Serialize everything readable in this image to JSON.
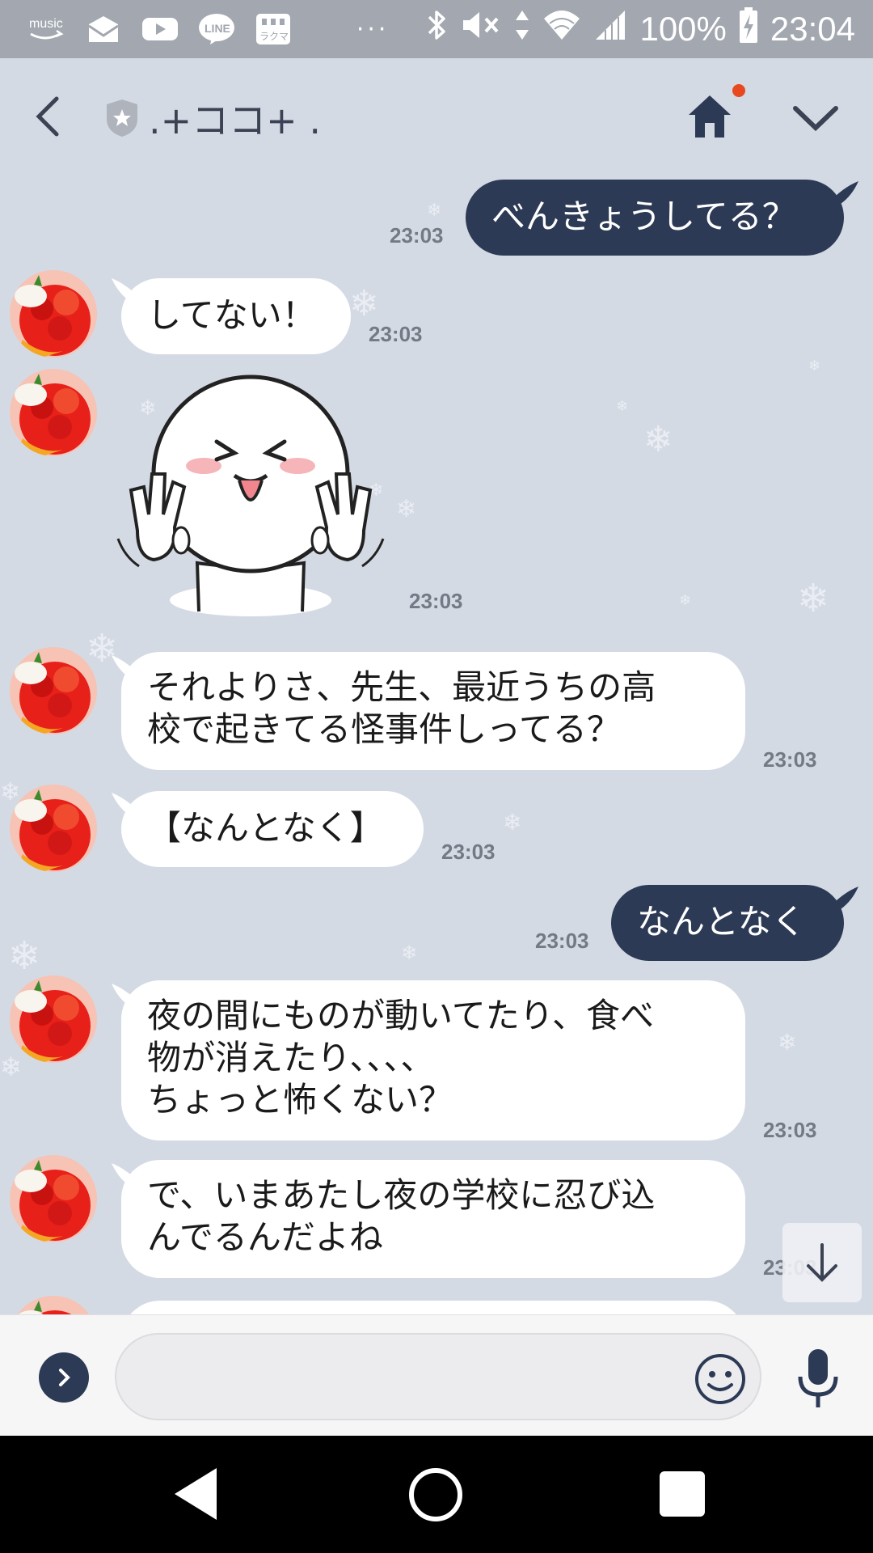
{
  "status_bar": {
    "icons": [
      "amazon-music-icon",
      "mail-icon",
      "youtube-icon",
      "line-icon",
      "rakuma-icon"
    ],
    "music_label": "music",
    "line_label": "LINE",
    "rakuma_label": "ラクマ",
    "overflow": "···",
    "battery": "100%",
    "time": "23:04"
  },
  "header": {
    "title": ".+ココ+ ."
  },
  "messages": [
    {
      "side": "out",
      "text": "べんきょうしてる？",
      "time": "23:03"
    },
    {
      "side": "in",
      "text": "してない！",
      "time": "23:03"
    },
    {
      "side": "in",
      "type": "sticker",
      "sticker": "moon-sticker",
      "time": "23:03"
    },
    {
      "side": "in",
      "text": "それよりさ、先生、最近うちの高\n校で起きてる怪事件しってる？",
      "time": "23:03"
    },
    {
      "side": "in",
      "text": "【なんとなく】",
      "time": "23:03"
    },
    {
      "side": "out",
      "text": "なんとなく",
      "time": "23:03"
    },
    {
      "side": "in",
      "text": "夜の間にものが動いてたり、食べ\n物が消えたり、、、、\nちょっと怖くない？",
      "time": "23:03"
    },
    {
      "side": "in",
      "text": "で、いまあたし夜の学校に忍び込\nんでるんだよね",
      "time": "23:03"
    }
  ],
  "input": {
    "placeholder": "",
    "value": ""
  },
  "colors": {
    "background": "#d4dae4",
    "outgoing_bubble": "#2d3a55",
    "incoming_bubble": "#ffffff",
    "notification_dot": "#e8481f"
  }
}
